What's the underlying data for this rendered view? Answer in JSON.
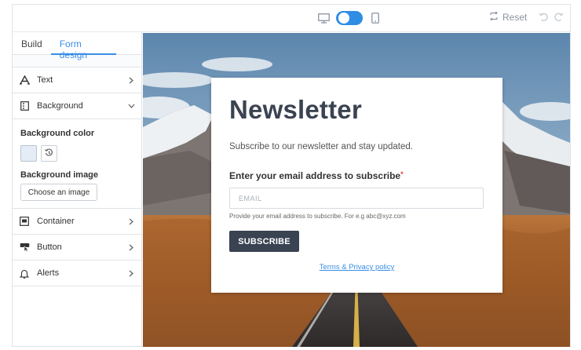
{
  "toolbar": {
    "desktop_icon": "desktop-icon",
    "toggle_icon": "toggle-switch",
    "mobile_icon": "mobile-icon",
    "reset_label": "Reset",
    "undo_icon": "undo-icon",
    "redo_icon": "redo-icon"
  },
  "sidebar": {
    "tabs": [
      {
        "label": "Build"
      },
      {
        "label": "Form design"
      }
    ],
    "items": [
      {
        "label": "Text",
        "icon": "text-icon"
      },
      {
        "label": "Background",
        "icon": "background-icon"
      },
      {
        "label": "Container",
        "icon": "container-icon"
      },
      {
        "label": "Button",
        "icon": "button-icon"
      },
      {
        "label": "Alerts",
        "icon": "bell-icon"
      }
    ],
    "background_panel": {
      "color_heading": "Background color",
      "color_value": "#e4ecf5",
      "image_heading": "Background image",
      "choose_label": "Choose an image"
    }
  },
  "form": {
    "title": "Newsletter",
    "subtitle": "Subscribe to our newsletter and stay updated.",
    "field_label": "Enter your email address to subscribe",
    "required_mark": "*",
    "email_placeholder": "EMAIL",
    "hint": "Provide your email address to subscribe. For e.g abc@xyz.com",
    "button_label": "SUBSCRIBE",
    "terms_link": "Terms & Privacy policy"
  },
  "colors": {
    "accent": "#3a8ee6",
    "button_dark": "#3a4352",
    "title": "#3b4352"
  }
}
